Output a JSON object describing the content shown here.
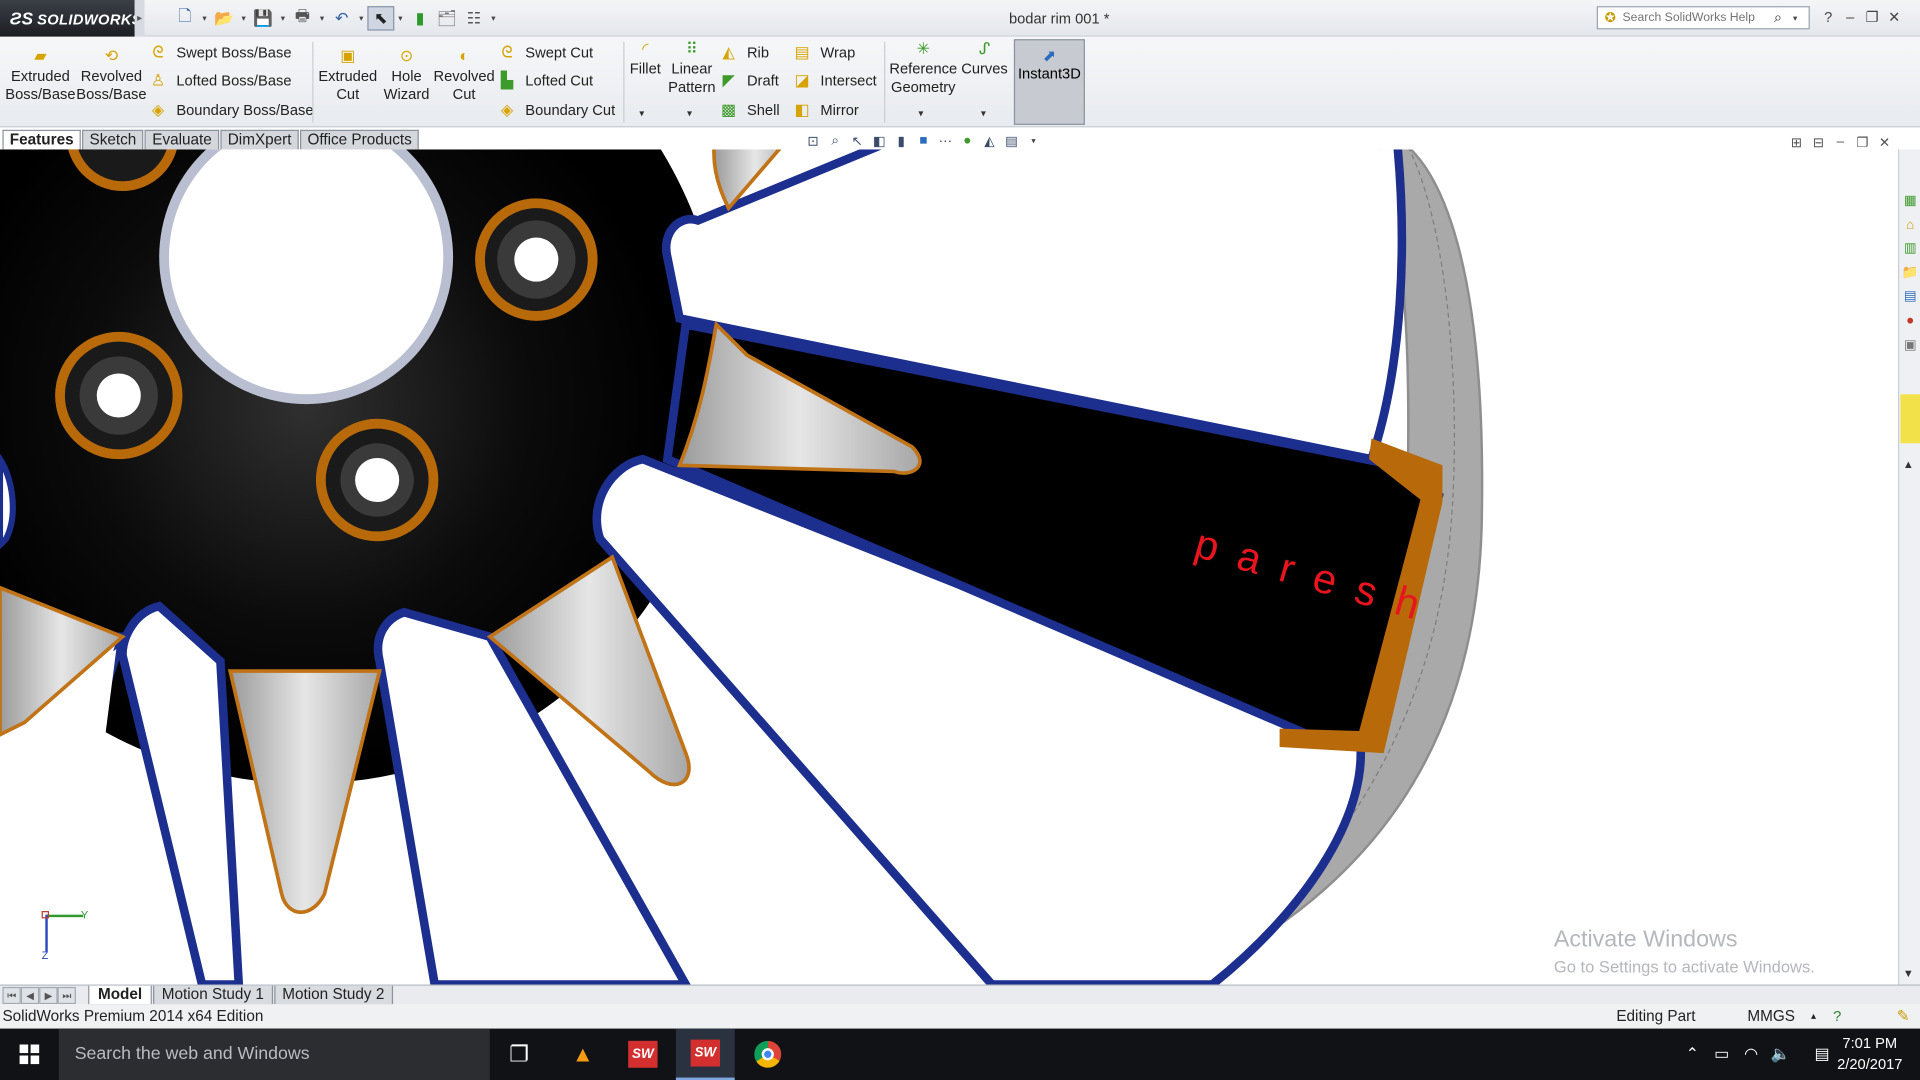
{
  "app": {
    "brand": "SOLIDWORKS",
    "document_title": "bodar rim 001 *",
    "search_placeholder": "Search SolidWorks Help"
  },
  "toolbar": {
    "extruded_boss": [
      "Extruded",
      "Boss/Base"
    ],
    "revolved_boss": [
      "Revolved",
      "Boss/Base"
    ],
    "swept_boss": "Swept Boss/Base",
    "lofted_boss": "Lofted Boss/Base",
    "boundary_boss": "Boundary Boss/Base",
    "extruded_cut": [
      "Extruded",
      "Cut"
    ],
    "hole_wizard": [
      "Hole",
      "Wizard"
    ],
    "revolved_cut": [
      "Revolved",
      "Cut"
    ],
    "swept_cut": "Swept Cut",
    "lofted_cut": "Lofted Cut",
    "boundary_cut": "Boundary Cut",
    "fillet": "Fillet",
    "linear_pattern": [
      "Linear",
      "Pattern"
    ],
    "rib": "Rib",
    "draft": "Draft",
    "shell": "Shell",
    "wrap": "Wrap",
    "intersect": "Intersect",
    "mirror": "Mirror",
    "reference_geometry": [
      "Reference",
      "Geometry"
    ],
    "curves": "Curves",
    "instant3d": "Instant3D"
  },
  "tabs": [
    "Features",
    "Sketch",
    "Evaluate",
    "DimXpert",
    "Office Products"
  ],
  "viewport": {
    "engraved_text": "paresh",
    "triad_y": "Y",
    "triad_z": "Z",
    "activation_title": "Activate Windows",
    "activation_subtitle": "Go to Settings to activate Windows."
  },
  "bottom_tabs": [
    "Model",
    "Motion Study 1",
    "Motion Study 2"
  ],
  "status": {
    "edition": "SolidWorks Premium 2014 x64 Edition",
    "mode": "Editing Part",
    "units": "MMGS"
  },
  "taskbar": {
    "search_placeholder": "Search the web and Windows",
    "sw_label": "SW",
    "time": "7:01 PM",
    "date": "2/20/2017"
  },
  "colors": {
    "rim_black": "#000000",
    "spoke_edge_blue": "#1c2f8f",
    "hole_ring_orange": "#b8690a",
    "spoke_silver": "#b9b9b9",
    "engraving_red": "#e8141e"
  }
}
